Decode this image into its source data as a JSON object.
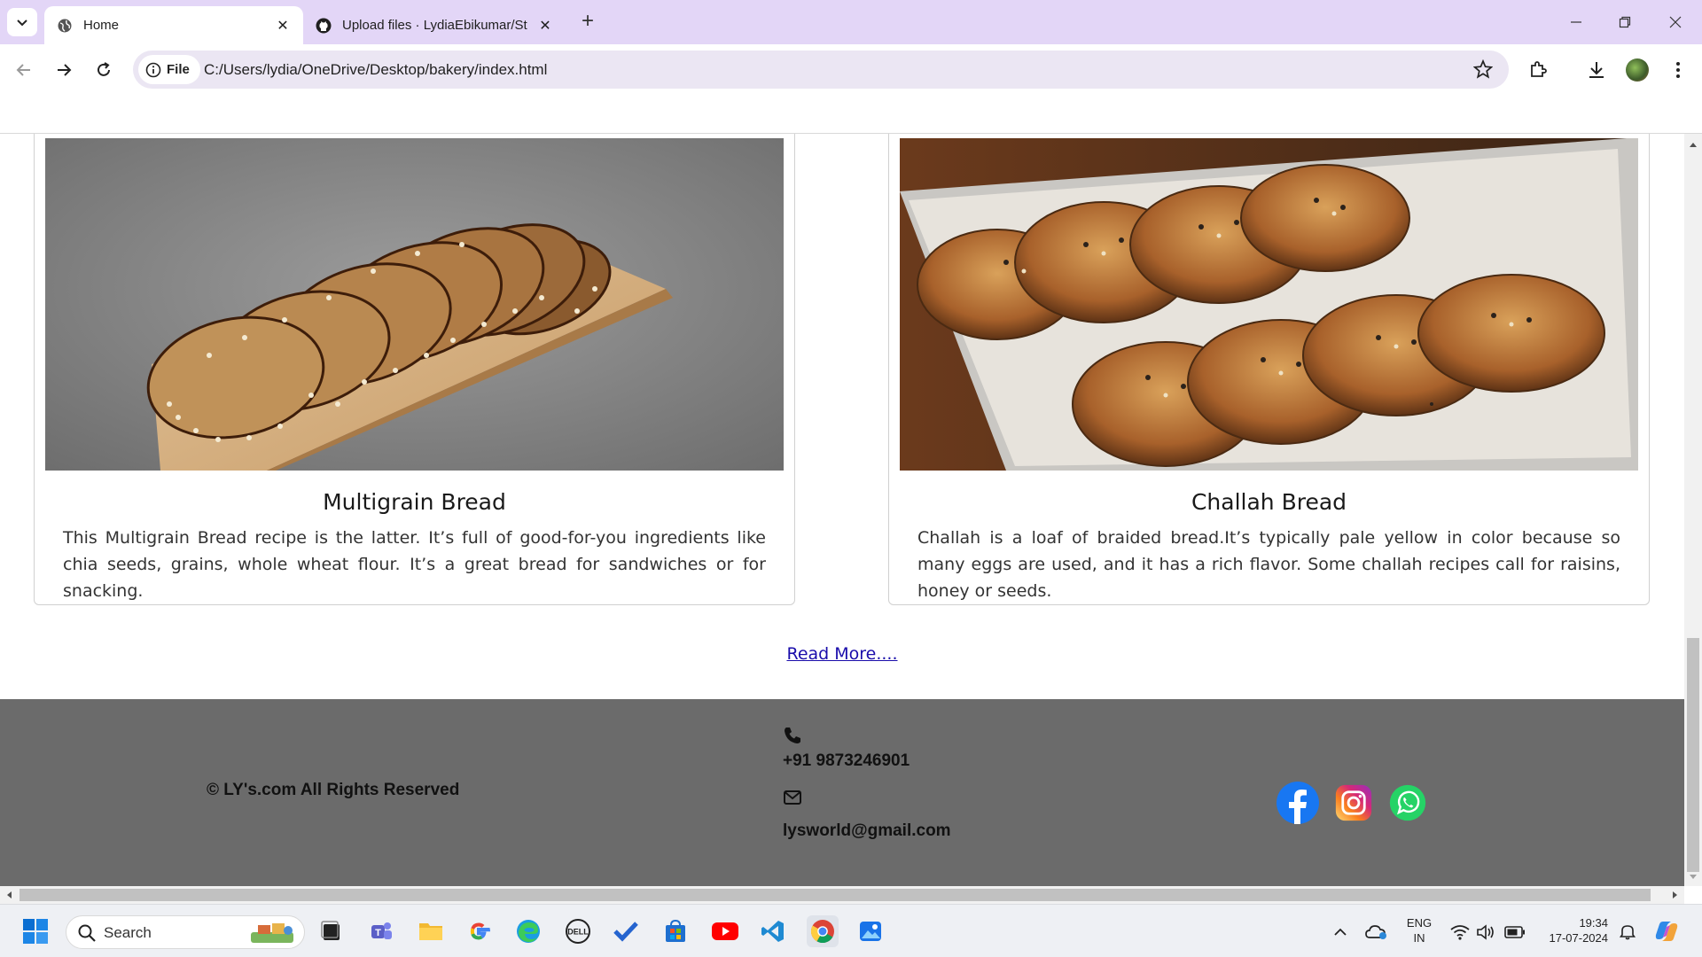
{
  "browser": {
    "tabs": [
      {
        "title": "Home",
        "active": true
      },
      {
        "title": "Upload files · LydiaEbikumar/St",
        "active": false
      }
    ],
    "new_tab_label": "+",
    "omnibox": {
      "chip_label": "File",
      "url": "C:/Users/lydia/OneDrive/Desktop/bakery/index.html"
    }
  },
  "cards": [
    {
      "title": "Multigrain Bread",
      "description": "This Multigrain Bread recipe is the latter. It’s full of good-for-you ingredients like chia seeds, grains, whole wheat flour. It’s a great bread for sandwiches or for snacking."
    },
    {
      "title": "Challah Bread",
      "description": "Challah is a loaf of braided bread.It’s typically pale yellow in color because so many eggs are used, and it has a rich flavor. Some challah recipes call for raisins, honey or seeds."
    }
  ],
  "read_more": "Read More....",
  "footer": {
    "copyright": "© LY's.com All Rights Reserved",
    "phone": "+91 9873246901",
    "email": "lysworld@gmail.com",
    "social": [
      "facebook-icon",
      "instagram-icon",
      "whatsapp-icon"
    ]
  },
  "taskbar": {
    "search_label": "Search",
    "language": "ENG",
    "region": "IN",
    "time": "19:34",
    "date": "17-07-2024"
  },
  "colors": {
    "tabstrip": "#e3d6f7",
    "footer_bg": "#6b6b6b",
    "link": "#1a0dab"
  }
}
